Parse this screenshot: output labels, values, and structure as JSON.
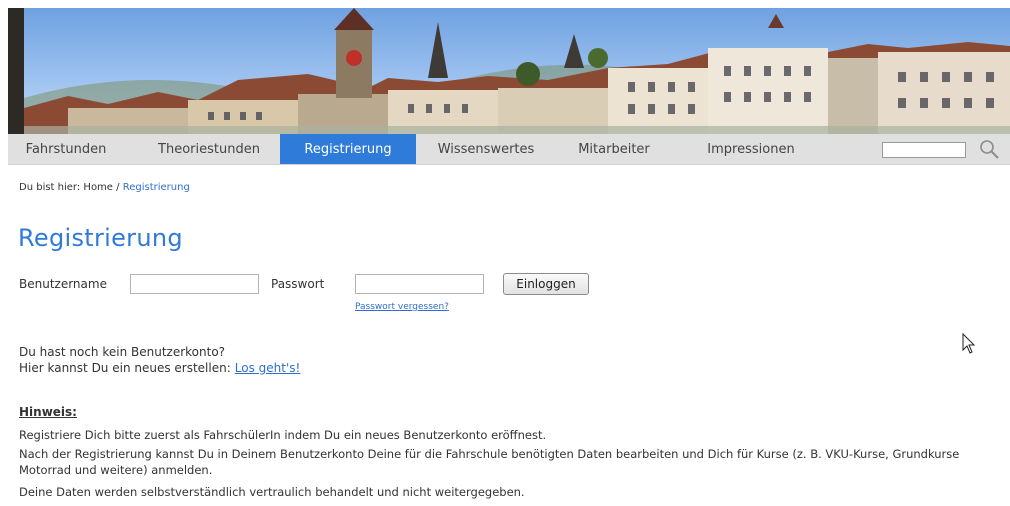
{
  "nav": {
    "items": [
      "Fahrstunden",
      "Theoriestunden",
      "Registrierung",
      "Wissenswertes",
      "Mitarbeiter",
      "Impressionen"
    ],
    "active_index": 2,
    "search_value": ""
  },
  "breadcrumb": {
    "prefix": "Du bist hier:",
    "home": "Home",
    "separator": "/",
    "current": "Registrierung"
  },
  "page": {
    "title": "Registrierung"
  },
  "login": {
    "username_label": "Benutzername",
    "username_value": "",
    "password_label": "Passwort",
    "password_value": "",
    "button_label": "Einloggen",
    "forgot_link": "Passwort vergessen?"
  },
  "signup": {
    "line1": "Du hast noch kein Benutzerkonto?",
    "line2": "Hier kannst Du ein neues erstellen:",
    "link": "Los geht's!"
  },
  "hint": {
    "title": "Hinweis:",
    "paragraphs": [
      "Registriere Dich bitte zuerst als FahrschülerIn indem Du ein neues Benutzerkonto eröffnest.",
      "Nach der Registrierung kannst Du in Deinem Benutzerkonto Deine für die Fahrschule benötigten Daten bearbeiten und Dich für Kurse (z. B. VKU-Kurse, Grundkurse Motorrad und weitere) anmelden.",
      "Deine Daten werden selbstverständlich vertraulich behandelt und nicht weitergegeben."
    ]
  },
  "icons": {
    "search": "magnifier-icon",
    "cursor": "mouse-pointer-icon"
  },
  "colors": {
    "accent": "#2f7bd9",
    "nav_bg": "#e0e0e0",
    "link": "#2f6fd0"
  }
}
